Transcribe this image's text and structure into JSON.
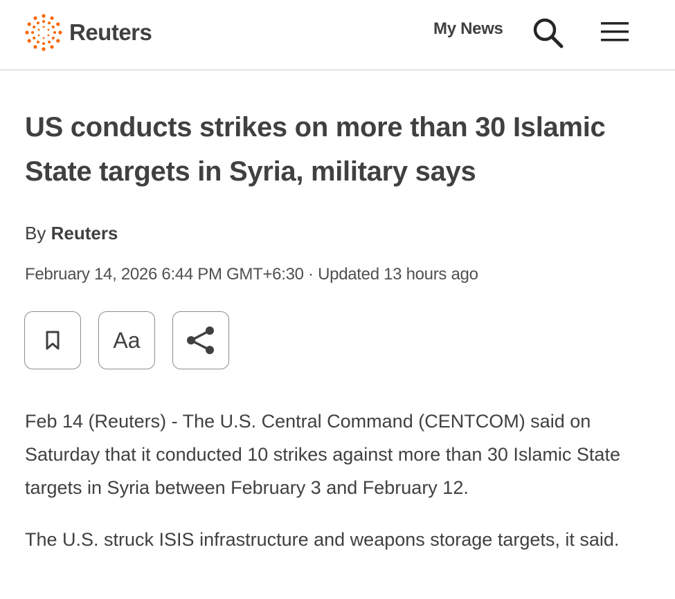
{
  "header": {
    "logo_text": "Reuters",
    "my_news_label": "My News",
    "search_icon": "search-icon",
    "menu_icon": "hamburger-menu-icon",
    "brand_color": "#fa6400"
  },
  "article": {
    "headline": "US conducts strikes on more than 30 Islamic State targets in Syria, military says",
    "byline_prefix": "By",
    "author": "Reuters",
    "dateline": "February 14, 2026 6:44 PM GMT+6:30 · Updated 13 hours ago",
    "tools": [
      {
        "name": "bookmark",
        "icon": "bookmark-icon"
      },
      {
        "name": "text-size",
        "label": "Aa"
      },
      {
        "name": "share",
        "icon": "share-icon"
      }
    ],
    "paragraphs": [
      "Feb 14 (Reuters) - The U.S. Central Command (CENTCOM) said on Saturday that it conducted 10 strikes against more than 30 Islamic State targets in Syria between February 3 and February 12.",
      "The U.S. struck ISIS infrastructure and weapons storage targets, it said."
    ]
  }
}
